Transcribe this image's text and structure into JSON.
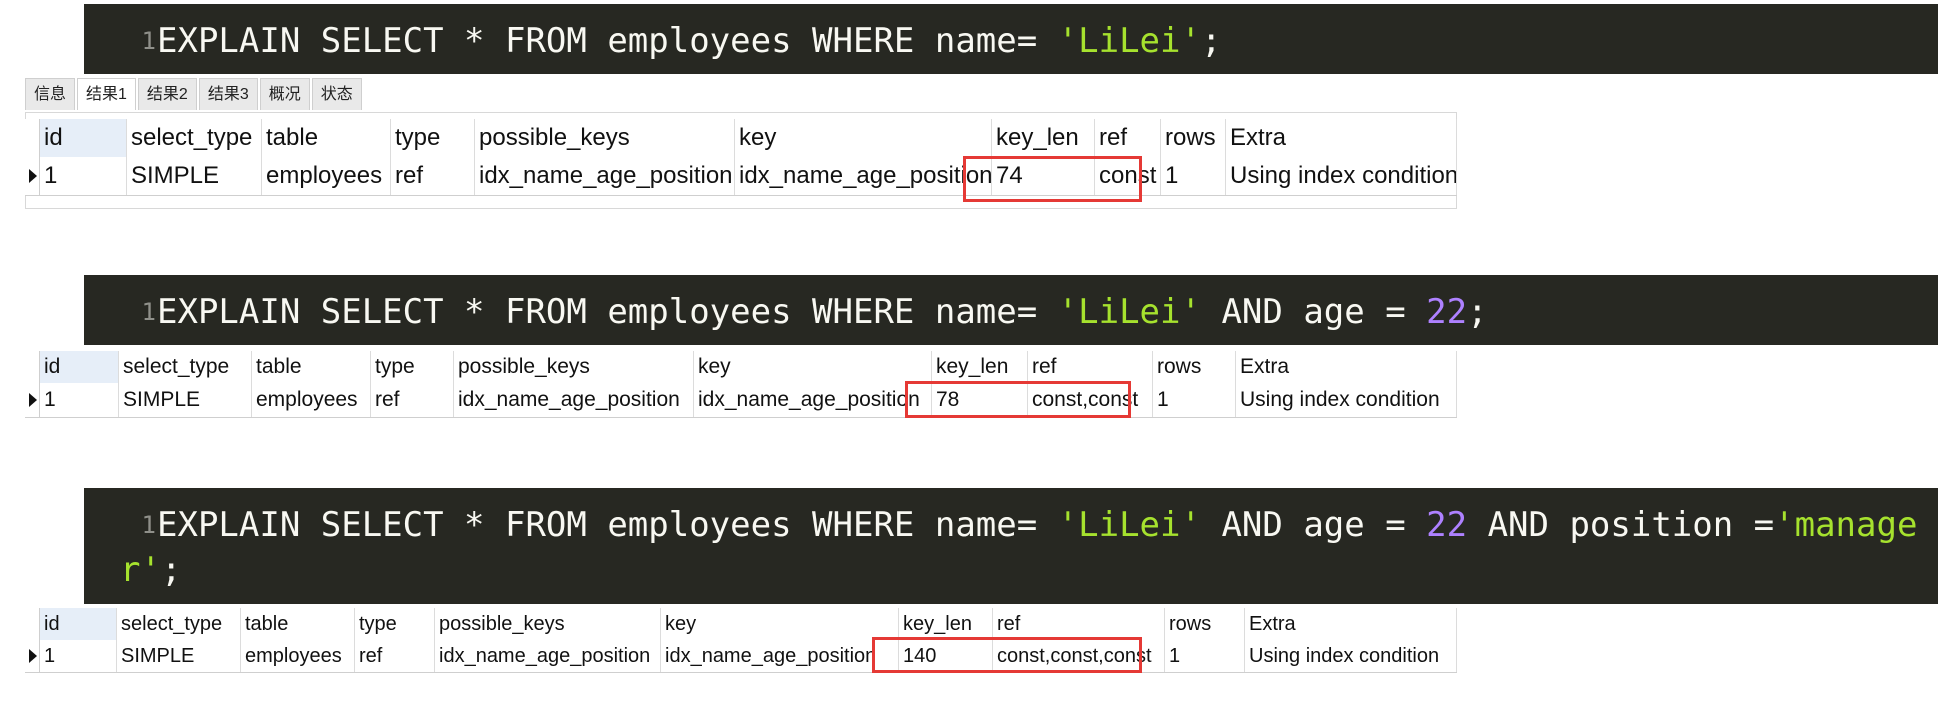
{
  "queries": [
    {
      "line_number": "1",
      "line1": [
        {
          "t": "EXPLAIN SELECT * FROM employees WHERE name= ",
          "c": "plain"
        },
        {
          "t": "'LiLei'",
          "c": "str"
        },
        {
          "t": ";",
          "c": "plain"
        }
      ],
      "line2": []
    },
    {
      "line_number": "1",
      "line1": [
        {
          "t": "EXPLAIN SELECT * FROM employees WHERE name= ",
          "c": "plain"
        },
        {
          "t": "'LiLei'",
          "c": "str"
        },
        {
          "t": " AND age = ",
          "c": "plain"
        },
        {
          "t": "22",
          "c": "num"
        },
        {
          "t": ";",
          "c": "plain"
        }
      ],
      "line2": []
    },
    {
      "line_number": "1",
      "line1": [
        {
          "t": "EXPLAIN SELECT * FROM employees WHERE name= ",
          "c": "plain"
        },
        {
          "t": "'LiLei'",
          "c": "str"
        },
        {
          "t": " AND age = ",
          "c": "plain"
        },
        {
          "t": "22",
          "c": "num"
        },
        {
          "t": " AND position =",
          "c": "plain"
        },
        {
          "t": "'manage",
          "c": "str"
        }
      ],
      "line2": [
        {
          "t": "r'",
          "c": "str"
        },
        {
          "t": ";",
          "c": "plain"
        }
      ]
    }
  ],
  "tabs": [
    "信息",
    "结果1",
    "结果2",
    "结果3",
    "概况",
    "状态"
  ],
  "active_tab": "结果1",
  "columns": [
    "id",
    "select_type",
    "table",
    "type",
    "possible_keys",
    "key",
    "key_len",
    "ref",
    "rows",
    "Extra"
  ],
  "results": [
    [
      "1",
      "SIMPLE",
      "employees",
      "ref",
      "idx_name_age_position",
      "idx_name_age_position",
      "74",
      "const",
      "1",
      "Using index condition"
    ],
    [
      "1",
      "SIMPLE",
      "employees",
      "ref",
      "idx_name_age_position",
      "idx_name_age_position",
      "78",
      "const,const",
      "1",
      "Using index condition"
    ],
    [
      "1",
      "SIMPLE",
      "employees",
      "ref",
      "idx_name_age_position",
      "idx_name_age_position",
      "140",
      "const,const,const",
      "1",
      "Using index condition"
    ]
  ],
  "highlight_color": "#e53935",
  "editor_background": "#272822",
  "string_color": "#a6e22e",
  "number_color": "#ae81ff"
}
